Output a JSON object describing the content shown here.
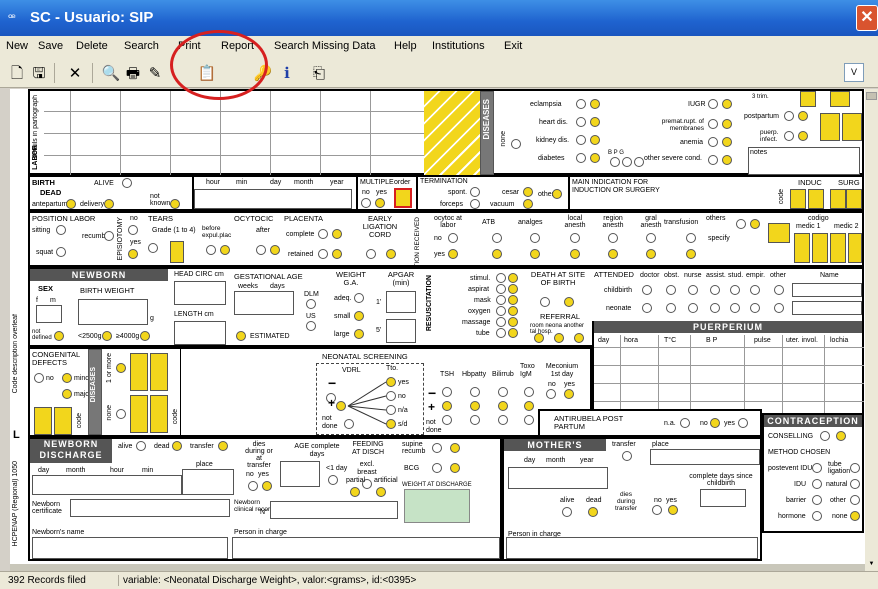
{
  "window": {
    "title": "SC - Usuario: SIP",
    "icon": "sip-app-icon",
    "close_icon": "close-icon",
    "close_glyph": "✕"
  },
  "menu": [
    "New",
    "Save",
    "Delete",
    "Search",
    "Print",
    "Report",
    "Search Missing Data",
    "Help",
    "Institutions",
    "Exit"
  ],
  "toolbar": {
    "buttons": [
      {
        "name": "new-document-icon",
        "glyph": "🗋"
      },
      {
        "name": "save-disk-icon",
        "glyph": "🖫"
      },
      {
        "name": "delete-x-icon",
        "glyph": "✕"
      },
      {
        "name": "binoculars-search-icon",
        "glyph": "🔍"
      },
      {
        "name": "printer-icon",
        "glyph": "🖶"
      },
      {
        "name": "report-icon",
        "glyph": "✎"
      },
      {
        "name": "missing-data-icon",
        "glyph": "📋"
      },
      {
        "name": "help-key-icon",
        "glyph": "🔑"
      },
      {
        "name": "info-icon",
        "glyph": "ℹ"
      },
      {
        "name": "exit-icon",
        "glyph": "⎗"
      }
    ],
    "dropdown": "V"
  },
  "sidebar": {
    "code": "Code description overleaf",
    "hcpenap": "HCPENAP (Regional) 1050",
    "letter": "L"
  },
  "labor": {
    "vert1": "details in partograph",
    "vert2": "LABOR",
    "diseases": "DISEASES",
    "none": "none",
    "diseases_list": [
      "eclampsia",
      "heart dis.",
      "kidney dis.",
      "diabetes"
    ],
    "right_list": [
      "IUGR",
      "premat.rupt. of membranes",
      "anemia",
      "other severe cond."
    ],
    "right2": [
      "postpartum",
      "puerp. infect."
    ],
    "notes": "notes",
    "bpg": "B P G",
    "months": "3 trim."
  },
  "birth": {
    "label": "BIRTH",
    "alive": "ALIVE",
    "dead": "DEAD",
    "antepartum": "antepartum",
    "delivery": "delivery",
    "not_known": "not known",
    "hour": "hour",
    "min": "min",
    "day": "day",
    "month": "month",
    "year": "year",
    "multiple": "MULTIPLE",
    "no": "no",
    "yes": "yes",
    "order": "order",
    "termination": "TERMINATION",
    "spont": "spont.",
    "cesar": "cesar",
    "forceps": "forceps",
    "vacuum": "vacuum",
    "other": "other",
    "main_indic": "MAIN INDICATION FOR INDUCTION OR SURGERY",
    "code": "code",
    "induc": "INDUC",
    "surg": "SURG"
  },
  "position": {
    "label": "POSITION LABOR",
    "sitting": "sitting",
    "recumb": "recumb",
    "squat": "squat",
    "episiotomy": "EPISIOTOMY",
    "no": "no",
    "yes": "yes",
    "tears": "TEARS",
    "grade": "Grade (1 to 4)",
    "ocytocic": "OCYTOCIC",
    "before": "before expul.plac",
    "after": "after",
    "placenta": "PLACENTA",
    "complete": "complete",
    "retained": "retained",
    "early": "EARLY LIGATION CORD",
    "medication": "MEDICATION RECEIVED",
    "meds": [
      "ocytoc at labor",
      "ATB",
      "analges",
      "local anesth",
      "region anesth",
      "gral anesth",
      "transfusion"
    ],
    "others": "others",
    "specify": "specify",
    "codigo": "codigo",
    "medic1": "medic 1",
    "medic2": "medic 2"
  },
  "newborn": {
    "title": "NEWBORN",
    "sex": "SEX",
    "f": "f",
    "m": "m",
    "not_defined": "not defined",
    "bw": "BIRTH WEIGHT",
    "g": "g",
    "lt": "<2500g",
    "gt": "≥4000g",
    "head": "HEAD CIRC cm",
    "length": "LENGTH cm",
    "ga": "GESTATIONAL AGE",
    "weeks": "weeks",
    "days": "days",
    "dlm": "DLM",
    "us": "US",
    "estimated": "ESTIMATED",
    "weight_ga": "WEIGHT G.A.",
    "adeq": "adeq.",
    "small": "small",
    "large": "large",
    "apgar": "APGAR (min)",
    "one": "1'",
    "five": "5'",
    "resus": "RESUSCITATION",
    "resus_items": [
      "stimul.",
      "aspirat",
      "mask",
      "oxygen",
      "massage",
      "tube"
    ],
    "death": "DEATH AT SITE OF BIRTH",
    "referral": "REFERRAL",
    "ref_cols": "room neona another tal hosp.",
    "attended": "ATTENDED",
    "att_cols": [
      "doctor",
      "obst.",
      "nurse",
      "assist.",
      "stud.",
      "empir.",
      "other"
    ],
    "name": "Name",
    "childbirth": "childbirth",
    "neonate": "neonate"
  },
  "puerperium": {
    "title": "PUERPERIUM",
    "cols": [
      "day",
      "hora",
      "T°C",
      "B P",
      "pulse",
      "uter. invol.",
      "lochia"
    ]
  },
  "congenital": {
    "label": "CONGENITAL DEFECTS",
    "no": "no",
    "minor": "minor",
    "major": "major",
    "code": "code",
    "diseases": "DISEASES",
    "one_or_more": "1 or more",
    "none": "none"
  },
  "screening": {
    "title": "NEONATAL SCREENING",
    "vdrl": "VDRL",
    "tto": "Tto.",
    "opts": [
      "yes",
      "no",
      "n/a",
      "s/d"
    ],
    "not_done": "not done",
    "tsh": "TSH",
    "hbpatty": "Hbpatty",
    "bilirub": "Bilirrub",
    "toxo": "Toxo IgM",
    "meconium": "Meconium 1st day",
    "antirubela": "ANTIRUBELA POST PARTUM",
    "na": "n.a."
  },
  "contraception": {
    "title": "CONTRACEPTION",
    "counselling": "CONSELLING",
    "method": "METHOD CHOSEN",
    "left": [
      "postevent IDU",
      "IDU",
      "barrier",
      "hormone"
    ],
    "right": [
      "tube ligation",
      "natural",
      "other",
      "none"
    ]
  },
  "nb_discharge": {
    "title": "NEWBORN DISCHARGE",
    "alive": "alive",
    "dead": "dead",
    "transfer": "transfer",
    "place": "place",
    "day": "day",
    "month": "month",
    "hour": "hour",
    "min": "min",
    "dies": "dies during or at transfer",
    "age": "AGE complete days",
    "lt1": "<1 day",
    "feeding": "FEEDING AT DISCH",
    "excl": "excl. breast",
    "partial": "partial",
    "artificial": "artificial",
    "supine": "supine recumb",
    "bcg": "BCG",
    "weight": "WEIGHT AT DISCHARGE",
    "cert": "Newborn certificate",
    "clinical": "Newborn clinical record",
    "n": "N°",
    "nb_name": "Newborn's name",
    "person": "Person in charge"
  },
  "mother_discharge": {
    "title": "MOTHER'S DISCHARGE",
    "transfer": "transfer",
    "place": "place",
    "day": "day",
    "month": "month",
    "year": "year",
    "alive": "alive",
    "dead": "dead",
    "dies": "dies during transfer",
    "complete": "complete days since childbirth",
    "no": "no",
    "yes": "yes",
    "person": "Person in charge"
  },
  "status": {
    "records": "392 Records filed",
    "variable": "variable: <Neonatal Discharge Weight>, valor:<grams>, id:<0395>"
  },
  "colors": {
    "titlebar": "#1f63cf",
    "highlight": "#f2d61c",
    "annotation": "#d62020",
    "header": "#555555"
  }
}
